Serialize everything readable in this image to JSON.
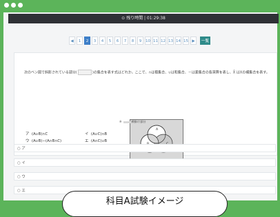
{
  "window": {
    "timer": "⊙ 残り時間 | 01:29:38"
  },
  "pager": {
    "pages": [
      "◀",
      "1",
      "2",
      "3",
      "4",
      "5",
      "6",
      "7",
      "8",
      "9",
      "10",
      "11",
      "12",
      "13",
      "14",
      "15",
      "▶"
    ],
    "active_page": "2",
    "all_label": "一覧"
  },
  "question": {
    "text_before_blank": "次のベン図で斜影されている部分(",
    "text_after_blank": ")の集合を表す式はどれか。ここで、∩は積集合、∪は和集合、－は差集合の各演算を表し、X̄ はXの補集合を表す。",
    "venn_labels": {
      "A": "A",
      "B": "B",
      "C": "C"
    },
    "legend_prefix": "※",
    "legend_text": "網掛け部分",
    "choices": [
      {
        "label": "ア",
        "expr": "(A∪B)∩C"
      },
      {
        "label": "イ",
        "expr": "(A∪C)∩B"
      },
      {
        "label": "ウ",
        "expr": "(A∪B)−(A∩B∩C)"
      },
      {
        "label": "エ",
        "expr": "(A∩C)∪B"
      }
    ]
  },
  "options": [
    "○ ア",
    "○ イ",
    "○ ウ",
    "○ エ"
  ],
  "overlay": {
    "caption": "科目A試験イメージ"
  }
}
